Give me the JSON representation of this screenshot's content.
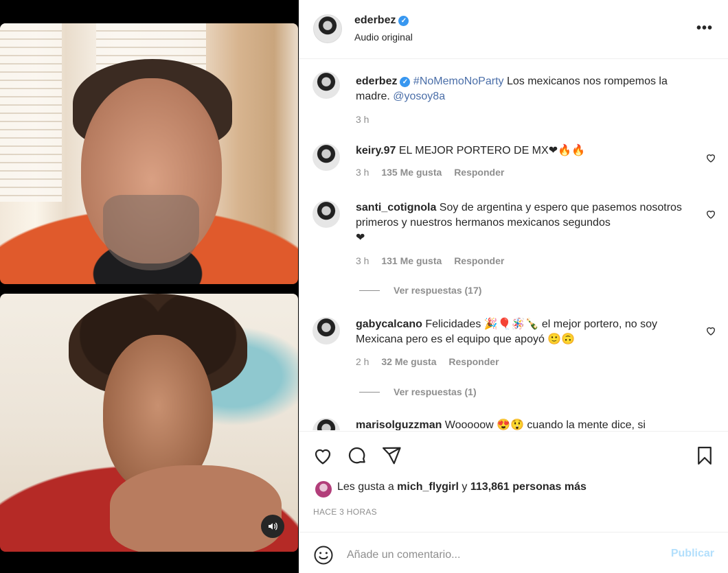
{
  "header": {
    "username": "ederbez",
    "subtitle": "Audio original"
  },
  "caption": {
    "username": "ederbez",
    "hashtag": "#NoMemoNoParty",
    "text": " Los mexicanos nos rompemos la madre. ",
    "mention": "@yosoy8a",
    "time": "3 h"
  },
  "comments": [
    {
      "username": "keiry.97",
      "text": " EL MEJOR PORTERO DE MX",
      "emoji": "❤🔥🔥",
      "time": "3 h",
      "likes": "135 Me gusta",
      "reply": "Responder"
    },
    {
      "username": "santi_cotignola",
      "text": " Soy de argentina y espero que pasemos nosotros primeros y nuestros hermanos mexicanos segundos",
      "emoji": "❤",
      "time": "3 h",
      "likes": "131 Me gusta",
      "reply": "Responder",
      "view_replies": "Ver respuestas (17)"
    },
    {
      "username": "gabycalcano",
      "text_1": " Felicidades ",
      "emoji_1": "🎉🎈🪅🍾",
      "text_2": " el mejor portero, no soy Mexicana pero es el equipo que apoyó ",
      "emoji_2": "🙂🙃",
      "time": "2 h",
      "likes": "32 Me gusta",
      "reply": "Responder",
      "view_replies": "Ver respuestas (1)"
    },
    {
      "username": "marisolguzzman",
      "text_1": " Wooooow ",
      "emoji": "😍😲",
      "text_2": " cuando la mente dice, si"
    }
  ],
  "likes": {
    "prefix": "Les gusta a ",
    "user": "mich_flygirl",
    "middle": " y ",
    "count": "113,861 personas más"
  },
  "timestamp": "HACE 3 HORAS",
  "composer": {
    "placeholder": "Añade un comentario...",
    "publish": "Publicar"
  },
  "icons": {
    "like": "heart-icon",
    "comment": "comment-icon",
    "share": "paper-plane-icon",
    "save": "bookmark-icon",
    "more": "ellipsis-icon",
    "emoji": "smiley-icon",
    "mute": "speaker-icon",
    "verified": "verified-badge-icon"
  },
  "colors": {
    "verified": "#3897f0",
    "link": "#385185",
    "muted": "#8e8e8e",
    "publish_disabled": "#b2dffc"
  }
}
